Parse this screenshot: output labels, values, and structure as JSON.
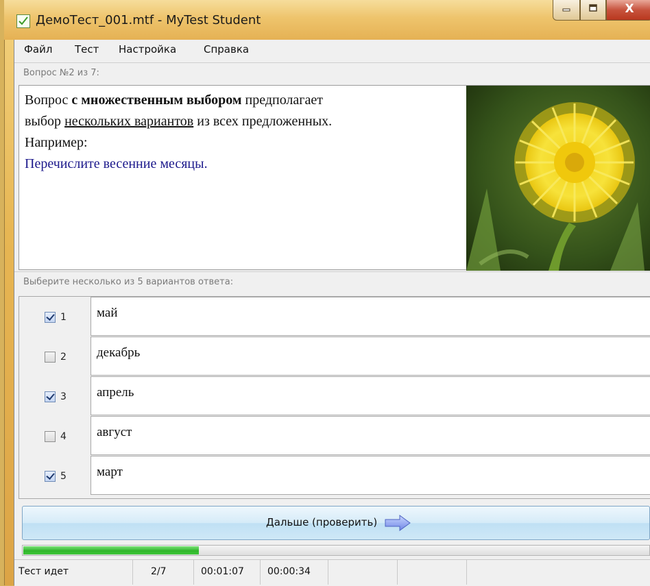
{
  "window": {
    "title": "ДемоТест_001.mtf - MyTest Student",
    "controls": {
      "minimize_icon": "minimize-icon",
      "maximize_icon": "maximize-icon",
      "close_glyph": "X"
    }
  },
  "menu": {
    "items": [
      "Файл",
      "Тест",
      "Настройка",
      "Справка"
    ]
  },
  "question": {
    "header": "Вопрос №2 из 7:",
    "text_part1": "Вопрос ",
    "text_bold": "с множественным выбором",
    "text_part2": " предполагает",
    "text_part3": "выбор ",
    "text_underlined": "нескольких вариантов",
    "text_part4": " из всех предложенных.",
    "text_part5": "Например:",
    "text_blue": "Перечислите весенние месяцы.",
    "image": "dandelion-photo"
  },
  "answers": {
    "header": "Выберите несколько из 5 вариантов ответа:",
    "items": [
      {
        "num": "1",
        "text": "май",
        "checked": true
      },
      {
        "num": "2",
        "text": "декабрь",
        "checked": false
      },
      {
        "num": "3",
        "text": "апрель",
        "checked": true
      },
      {
        "num": "4",
        "text": "август",
        "checked": false
      },
      {
        "num": "5",
        "text": "март",
        "checked": true
      }
    ]
  },
  "next_button": {
    "label": "Дальше (проверить)",
    "icon": "right-arrow-icon"
  },
  "progress": {
    "fraction": 0.28
  },
  "status": {
    "state": "Тест идет",
    "counter": "2/7",
    "elapsed": "00:01:07",
    "question_time": "00:00:34"
  },
  "colors": {
    "accent_blue_text": "#1d1a8c",
    "progress_green": "#2fb52a",
    "window_frame": "#e7b653"
  }
}
